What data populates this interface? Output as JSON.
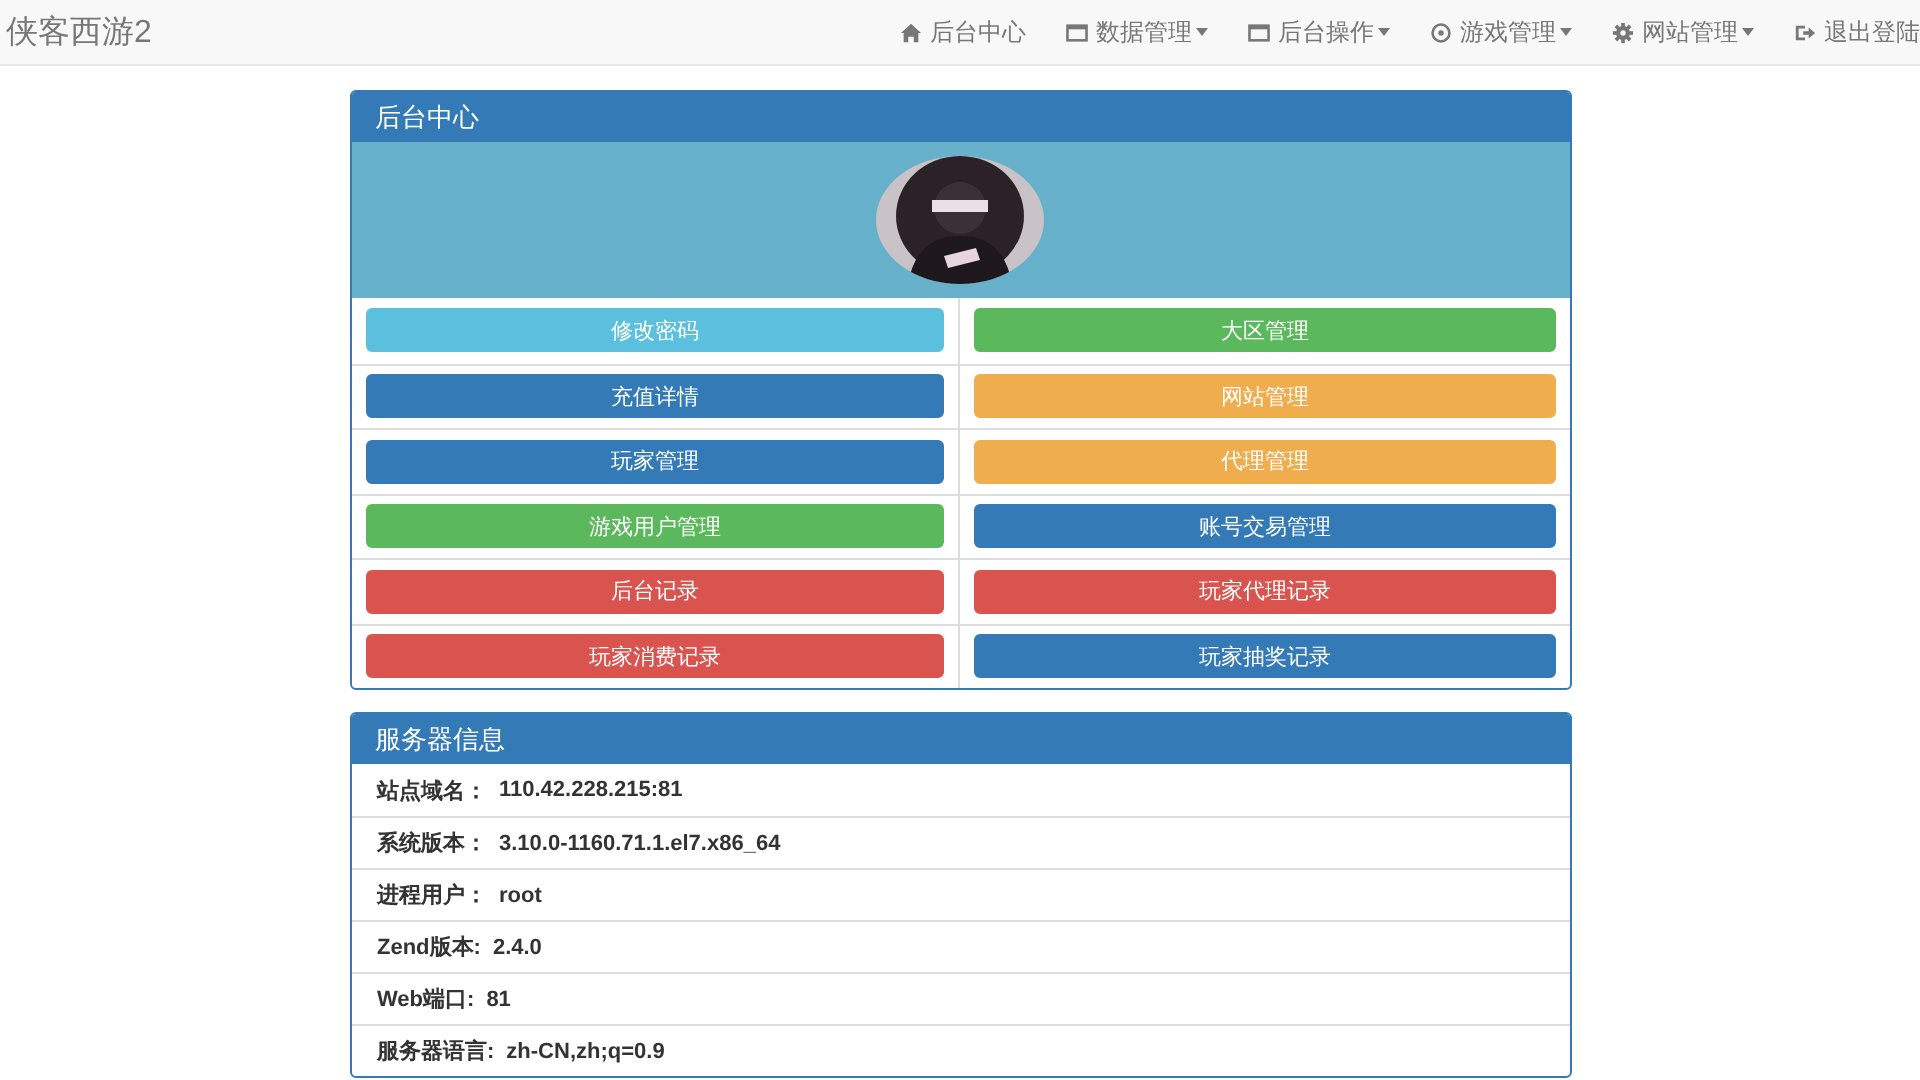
{
  "navbar": {
    "brand": "侠客西游2",
    "items": [
      {
        "label": "后台中心",
        "dropdown": false
      },
      {
        "label": "数据管理",
        "dropdown": true
      },
      {
        "label": "后台操作",
        "dropdown": true
      },
      {
        "label": "游戏管理",
        "dropdown": true
      },
      {
        "label": "网站管理",
        "dropdown": true
      },
      {
        "label": "退出登陆",
        "dropdown": false
      }
    ]
  },
  "admin_panel": {
    "title": "后台中心",
    "buttons": [
      {
        "label": "修改密码",
        "color": "#5bc0de"
      },
      {
        "label": "大区管理",
        "color": "#5cb85c"
      },
      {
        "label": "充值详情",
        "color": "#337ab7"
      },
      {
        "label": "网站管理",
        "color": "#f0ad4e"
      },
      {
        "label": "玩家管理",
        "color": "#337ab7"
      },
      {
        "label": "代理管理",
        "color": "#f0ad4e"
      },
      {
        "label": "游戏用户管理",
        "color": "#5cb85c"
      },
      {
        "label": "账号交易管理",
        "color": "#337ab7"
      },
      {
        "label": "后台记录",
        "color": "#d9534f"
      },
      {
        "label": "玩家代理记录",
        "color": "#d9534f"
      },
      {
        "label": "玩家消费记录",
        "color": "#d9534f"
      },
      {
        "label": "玩家抽奖记录",
        "color": "#337ab7"
      }
    ]
  },
  "server_panel": {
    "title": "服务器信息",
    "rows": [
      {
        "label": "站点域名：",
        "value": "110.42.228.215:81"
      },
      {
        "label": "系统版本：",
        "value": "3.10.0-1160.71.1.el7.x86_64"
      },
      {
        "label": "进程用户：",
        "value": "root"
      },
      {
        "label": "Zend版本:",
        "value": "2.4.0"
      },
      {
        "label": "Web端口:",
        "value": "81"
      },
      {
        "label": "服务器语言:",
        "value": "zh-CN,zh;q=0.9"
      }
    ]
  }
}
